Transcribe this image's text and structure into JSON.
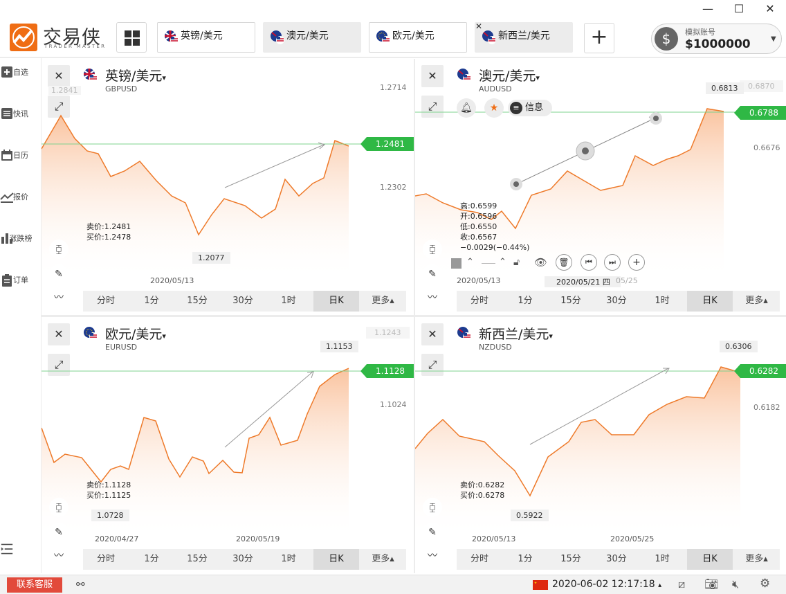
{
  "app": {
    "logo_cn": "交易侠",
    "logo_en": "TRADER MASTER"
  },
  "window_controls": {
    "minimize": "—",
    "maximize": "☐",
    "close": "✕"
  },
  "tabs": [
    {
      "label": "英镑/美元",
      "flag": "gb"
    },
    {
      "label": "澳元/美元",
      "flag": "au"
    },
    {
      "label": "欧元/美元",
      "flag": "eu"
    },
    {
      "label": "新西兰/美元",
      "flag": "nz"
    }
  ],
  "account": {
    "label": "模拟账号",
    "balance": "$1000000"
  },
  "sidebar": [
    {
      "label": "自选"
    },
    {
      "label": "快讯"
    },
    {
      "label": "日历"
    },
    {
      "label": "报价"
    },
    {
      "label": "涨跌榜"
    },
    {
      "label": "订单"
    }
  ],
  "timeframes": [
    "分时",
    "1分",
    "15分",
    "30分",
    "1时",
    "日K",
    "更多▴"
  ],
  "panels": [
    {
      "title": "英镑/美元",
      "symbol": "GBPUSD",
      "levels": [
        "1.2841",
        "1.2714",
        "1.2302"
      ],
      "current": "1.2481",
      "sell": "卖价:1.2481",
      "buy": "买价:1.2478",
      "low": "1.2077",
      "dates": [
        "2020/05/13"
      ]
    },
    {
      "title": "澳元/美元",
      "symbol": "AUDUSD",
      "levels": [
        "0.6870",
        "0.6813",
        "0.6676"
      ],
      "current": "0.6788",
      "info_label": "信息",
      "ohlc": [
        "高:0.6599",
        "开:0.6596",
        "低:0.6550",
        "收:0.6567",
        "−0.0029(−0.44%)"
      ],
      "dates": [
        "2020/05/13",
        "2020/05/21 四",
        "05/25"
      ]
    },
    {
      "title": "欧元/美元",
      "symbol": "EURUSD",
      "levels": [
        "1.1243",
        "1.1153",
        "1.1024"
      ],
      "current": "1.1128",
      "sell": "卖价:1.1128",
      "buy": "买价:1.1125",
      "low": "1.0728",
      "dates": [
        "2020/04/27",
        "2020/05/19"
      ]
    },
    {
      "title": "新西兰/美元",
      "symbol": "NZDUSD",
      "levels": [
        "0.6306",
        "0.6182"
      ],
      "current": "0.6282",
      "sell": "卖价:0.6282",
      "buy": "买价:0.6278",
      "low": "0.5922",
      "dates": [
        "2020/05/13",
        "2020/05/25"
      ]
    }
  ],
  "bottom": {
    "contact": "联系客服",
    "datetime": "2020-06-02 12:17:18"
  },
  "colors": {
    "accent": "#ef6d14",
    "up": "#2fb845",
    "contact": "#e24a3b"
  }
}
